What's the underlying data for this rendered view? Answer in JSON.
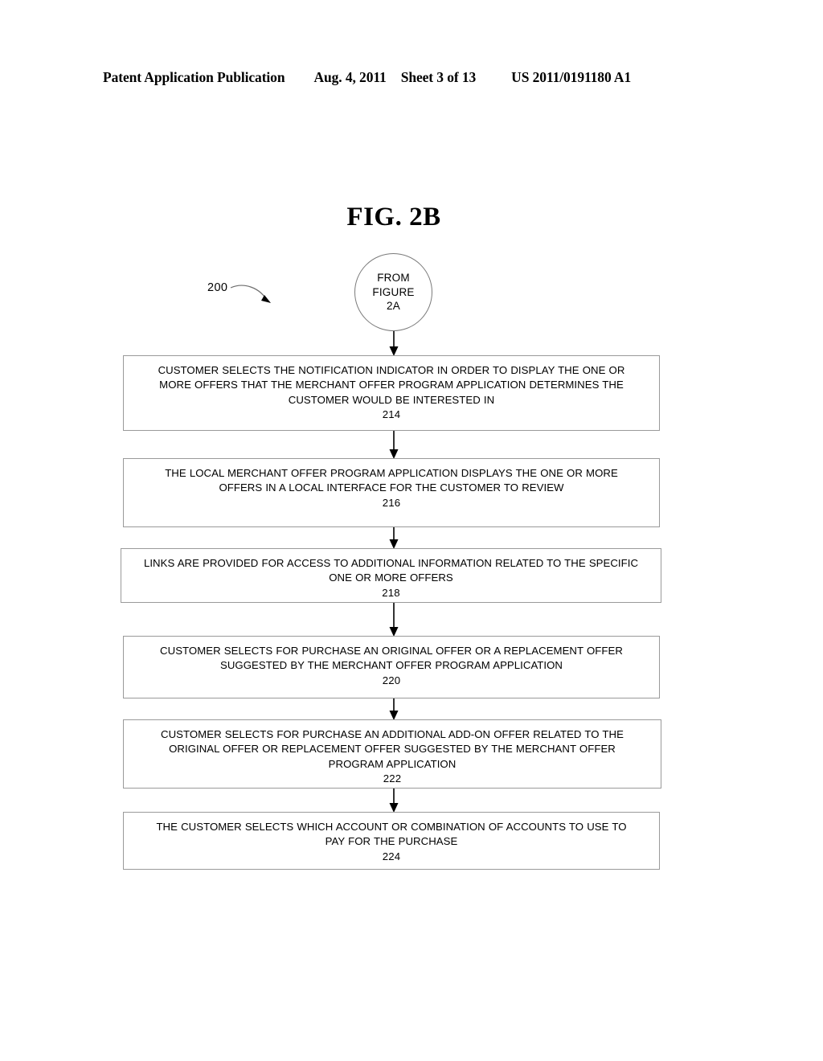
{
  "header": {
    "publication": "Patent Application Publication",
    "date": "Aug. 4, 2011",
    "sheet": "Sheet 3 of 13",
    "patent_number": "US 2011/0191180 A1"
  },
  "figure": {
    "title": "FIG. 2B",
    "reference_numeral": "200"
  },
  "connector": {
    "line1": "FROM",
    "line2": "FIGURE",
    "line3": "2A"
  },
  "flow": {
    "steps": [
      {
        "id": "214",
        "text": "CUSTOMER SELECTS THE NOTIFICATION INDICATOR IN ORDER TO DISPLAY THE ONE OR MORE OFFERS THAT THE MERCHANT OFFER PROGRAM APPLICATION DETERMINES THE CUSTOMER WOULD BE INTERESTED IN",
        "ref": "214"
      },
      {
        "id": "216",
        "text": "THE LOCAL MERCHANT OFFER PROGRAM APPLICATION DISPLAYS THE ONE OR MORE OFFERS IN A LOCAL INTERFACE FOR THE CUSTOMER TO REVIEW",
        "ref": "216"
      },
      {
        "id": "218",
        "text": "LINKS ARE PROVIDED FOR ACCESS TO ADDITIONAL INFORMATION RELATED TO THE SPECIFIC ONE OR MORE OFFERS",
        "ref": "218"
      },
      {
        "id": "220",
        "text": "CUSTOMER SELECTS FOR PURCHASE AN ORIGINAL OFFER OR A REPLACEMENT OFFER SUGGESTED BY THE MERCHANT OFFER PROGRAM APPLICATION",
        "ref": "220"
      },
      {
        "id": "222",
        "text": "CUSTOMER SELECTS FOR PURCHASE AN ADDITIONAL ADD-ON OFFER RELATED TO THE ORIGINAL OFFER OR REPLACEMENT OFFER SUGGESTED BY THE MERCHANT OFFER PROGRAM APPLICATION",
        "ref": "222"
      },
      {
        "id": "224",
        "text": "THE CUSTOMER SELECTS WHICH ACCOUNT OR COMBINATION OF ACCOUNTS TO USE TO PAY FOR THE PURCHASE",
        "ref": "224"
      }
    ]
  },
  "colors": {
    "ink": "#000000",
    "box_border": "#9a9a9a",
    "circle_border": "#7a7a7a",
    "background": "#ffffff"
  }
}
